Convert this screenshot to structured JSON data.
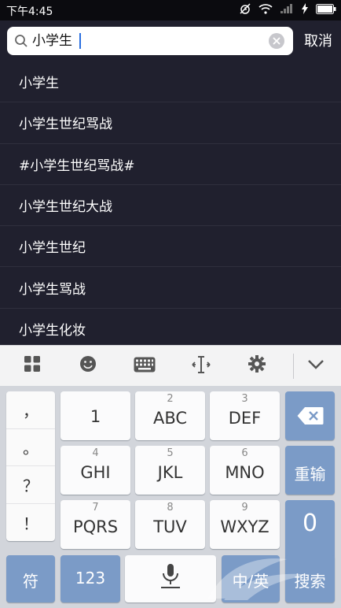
{
  "status_bar": {
    "time": "下午4:45"
  },
  "search": {
    "query": "小学生",
    "cancel_label": "取消"
  },
  "suggestions": [
    "小学生",
    "小学生世纪骂战",
    "#小学生世纪骂战#",
    "小学生世纪大战",
    "小学生世纪",
    "小学生骂战",
    "小学生化妆"
  ],
  "keyboard": {
    "punctuation": [
      "，",
      "。",
      "？",
      "！"
    ],
    "keys": [
      {
        "num": "",
        "letters": "1"
      },
      {
        "num": "2",
        "letters": "ABC"
      },
      {
        "num": "3",
        "letters": "DEF"
      },
      {
        "num": "4",
        "letters": "GHI"
      },
      {
        "num": "5",
        "letters": "JKL"
      },
      {
        "num": "6",
        "letters": "MNO"
      },
      {
        "num": "7",
        "letters": "PQRS"
      },
      {
        "num": "8",
        "letters": "TUV"
      },
      {
        "num": "9",
        "letters": "WXYZ"
      }
    ],
    "reenter_label": "重输",
    "zero_label": "0",
    "symbol_label": "符",
    "numbers_label": "123",
    "chinese_label": "中/英",
    "search_label": "搜索"
  },
  "colors": {
    "background": "#20202e",
    "keyboard": "#d2d5db",
    "accent_key": "#7b9bc7"
  }
}
